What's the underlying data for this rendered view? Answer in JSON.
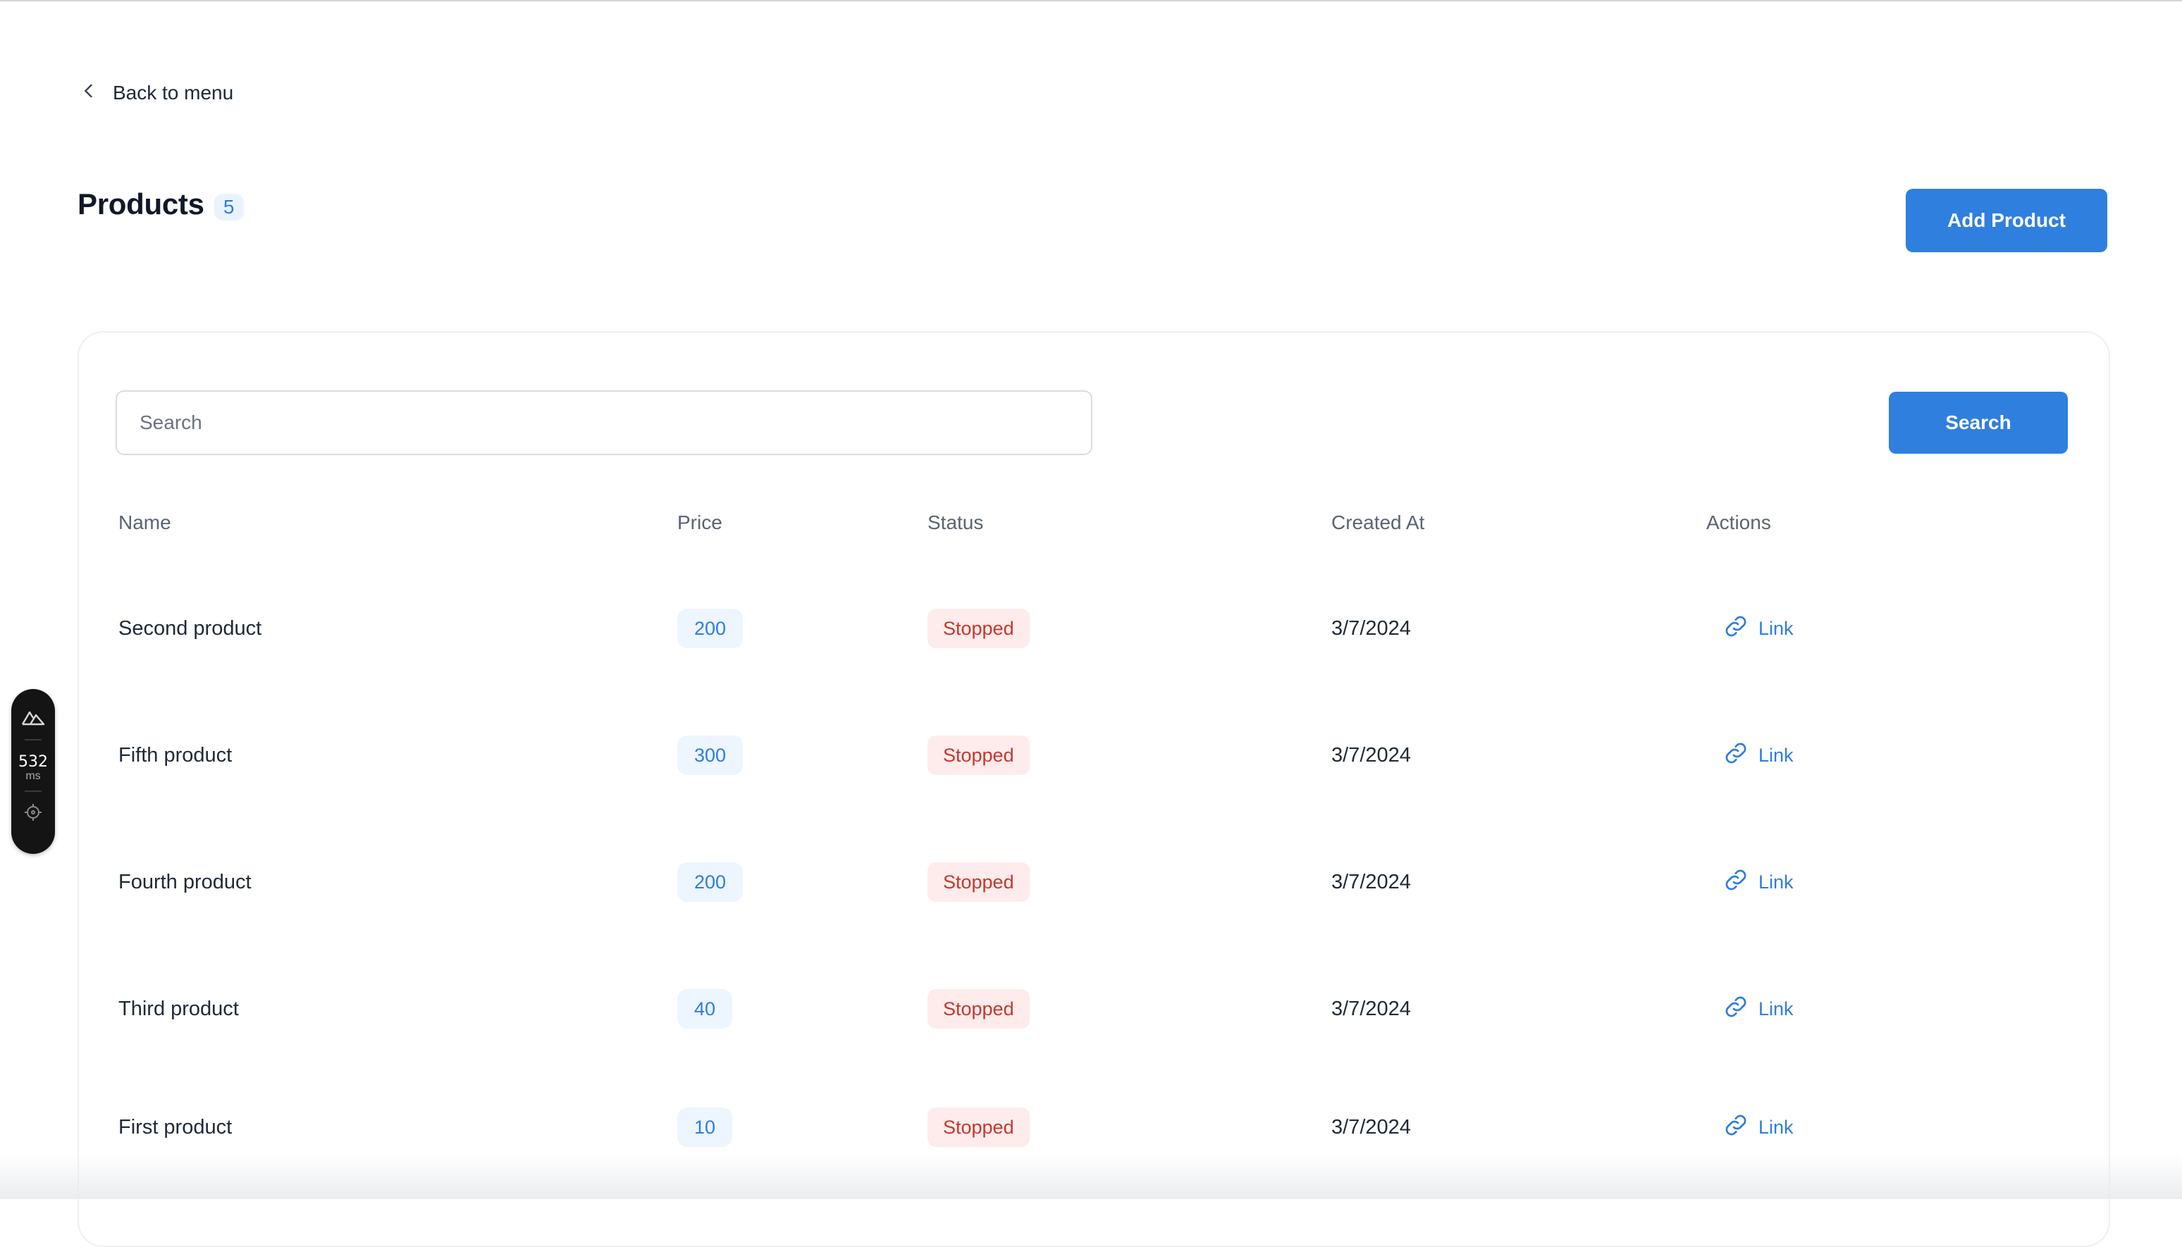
{
  "nav": {
    "back_label": "Back to menu"
  },
  "header": {
    "title": "Products",
    "count": "5",
    "add_button_label": "Add Product"
  },
  "search": {
    "placeholder": "Search",
    "value": "",
    "button_label": "Search"
  },
  "table": {
    "columns": [
      "Name",
      "Price",
      "Status",
      "Created At",
      "Actions"
    ],
    "rows": [
      {
        "name": "Second product",
        "price": "200",
        "status": "Stopped",
        "created_at": "3/7/2024",
        "action": "Link"
      },
      {
        "name": "Fifth product",
        "price": "300",
        "status": "Stopped",
        "created_at": "3/7/2024",
        "action": "Link"
      },
      {
        "name": "Fourth product",
        "price": "200",
        "status": "Stopped",
        "created_at": "3/7/2024",
        "action": "Link"
      },
      {
        "name": "Third product",
        "price": "40",
        "status": "Stopped",
        "created_at": "3/7/2024",
        "action": "Link"
      },
      {
        "name": "First product",
        "price": "10",
        "status": "Stopped",
        "created_at": "3/7/2024",
        "action": "Link"
      }
    ]
  },
  "devtools": {
    "value": "532",
    "unit": "ms",
    "icons": [
      "nuxt-logo-icon",
      "target-icon"
    ]
  },
  "colors": {
    "primary": "#2f7fdf",
    "price_badge_bg": "#edf5fe",
    "status_stopped_bg": "#fdeceb",
    "status_stopped_text": "#c5372e"
  }
}
